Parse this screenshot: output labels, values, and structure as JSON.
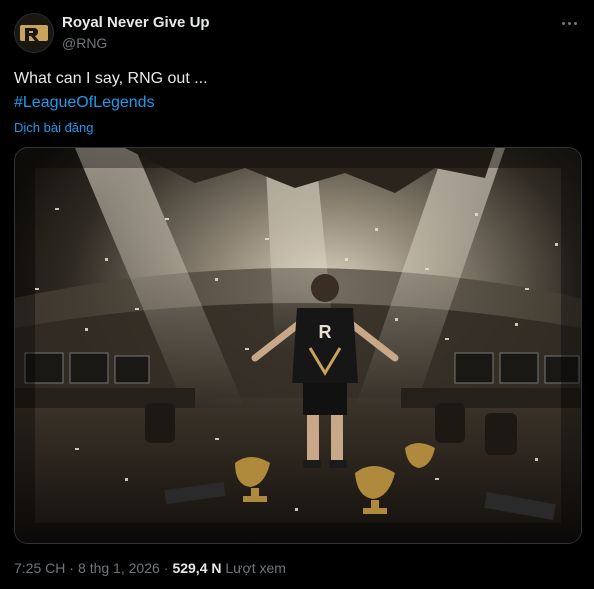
{
  "author": {
    "name": "Royal Never Give Up",
    "handle": "@RNG"
  },
  "post": {
    "text": "What can I say, RNG out ...",
    "hashtag": "#LeagueOfLegends",
    "translate_label": "Dịch bài đăng"
  },
  "media": {
    "jersey_letters": "R"
  },
  "meta": {
    "time": "7:25 CH",
    "separator": "·",
    "date": "8 thg 1, 2026",
    "views_count": "529,4 N",
    "views_label": "Lượt xem"
  },
  "colors": {
    "background": "#000000",
    "text": "#e7e9ea",
    "muted": "#71767b",
    "link": "#1d9bf0"
  },
  "icons": {
    "more": "more-horizontal-icon",
    "avatar_logo": "rng-logo"
  }
}
